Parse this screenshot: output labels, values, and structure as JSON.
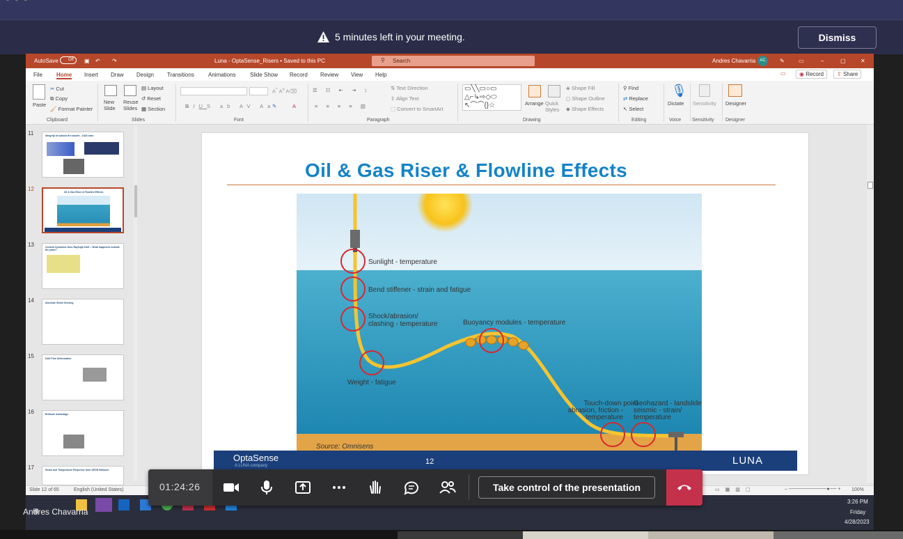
{
  "meeting": {
    "banner_text": "5 minutes left in your meeting.",
    "dismiss_label": "Dismiss",
    "timer": "01:24:26",
    "take_control_label": "Take control of the presentation",
    "presenter_name": "Andres Chavarria"
  },
  "app": {
    "autosave_label": "AutoSave",
    "autosave_state": "Off",
    "doc_title": "Luna - OptaSense_Risers  •  Saved to this PC",
    "search_placeholder": "Search",
    "user_name": "Andres Chavarria",
    "user_initials": "AC",
    "record_label": "Record",
    "share_label": "Share"
  },
  "menu": [
    "File",
    "Home",
    "Insert",
    "Draw",
    "Design",
    "Transitions",
    "Animations",
    "Slide Show",
    "Record",
    "Review",
    "View",
    "Help"
  ],
  "ribbon": {
    "clipboard": {
      "paste": "Paste",
      "cut": "Cut",
      "copy": "Copy",
      "format_painter": "Format Painter",
      "label": "Clipboard"
    },
    "slides": {
      "new_slide": "New Slide",
      "reuse_slides": "Reuse Slides",
      "layout": "Layout",
      "reset": "Reset",
      "section": "Section",
      "label": "Slides"
    },
    "font_label": "Font",
    "paragraph": {
      "text_direction": "Text Direction",
      "align_text": "Align Text",
      "convert": "Convert to SmartArt",
      "label": "Paragraph"
    },
    "drawing": {
      "arrange": "Arrange",
      "quick_styles": "Quick Styles",
      "shape_fill": "Shape Fill",
      "shape_outline": "Shape Outline",
      "shape_effects": "Shape Effects",
      "label": "Drawing"
    },
    "editing": {
      "find": "Find",
      "replace": "Replace",
      "select": "Select",
      "label": "Editing"
    },
    "voice": {
      "dictate": "Dictate",
      "label": "Voice"
    },
    "sensitivity": {
      "btn": "Sensitivity",
      "label": "Sensitivity"
    },
    "designer": {
      "btn": "Designer",
      "label": "Designer"
    }
  },
  "thumbnails": [
    {
      "num": "11",
      "title": "Integrity of subsea fire assets – DAS case"
    },
    {
      "num": "12",
      "title": "Oil & Gas Riser & Flowline Effects"
    },
    {
      "num": "13",
      "title": "Content Dynamics from Rayleigh DAS – What happened outside the plant?"
    },
    {
      "num": "14",
      "title": "Absolute Strain Sensing"
    },
    {
      "num": "15",
      "title": "DAS Plus Deformation"
    },
    {
      "num": "16",
      "title": "Brillouin Advantage"
    },
    {
      "num": "17",
      "title": "Strain and Temperature Response from OFDR Brillouin"
    }
  ],
  "slide": {
    "title": "Oil & Gas Riser & Flowline Effects",
    "labels": {
      "sunlight": "Sunlight - temperature",
      "bend": "Bend stiffener - strain and fatigue",
      "shock1": "Shock/abrasion/",
      "shock2": "clashing - temperature",
      "buoyancy": "Buoyancy modules - temperature",
      "weight": "Weight - fatigue",
      "touch1": "Touch-down point -",
      "touch2": "abrasion, friction -",
      "touch3": "temperature",
      "geo1": "Geohazard - landslide,",
      "geo2": "seismic - strain/",
      "geo3": "temperature",
      "source": "Source: Omnisens"
    },
    "footer": {
      "brand": "OptaSense",
      "sub": "A LUNA company",
      "page": "12",
      "logo": "LUNA"
    }
  },
  "status": {
    "slide_info": "Slide 12 of 65",
    "language": "English (United States)",
    "zoom": "100%"
  },
  "clock": {
    "time": "3:26 PM",
    "day": "Friday",
    "date": "4/28/2023"
  }
}
